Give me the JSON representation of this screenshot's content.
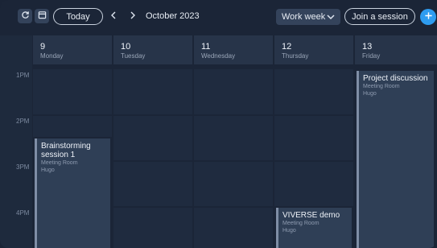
{
  "toolbar": {
    "refresh_icon": "refresh-icon",
    "calendar_icon": "calendar-icon",
    "today_label": "Today",
    "prev_icon": "chevron-left-icon",
    "next_icon": "chevron-right-icon",
    "month_label": "October 2023",
    "view_label": "Work week",
    "join_label": "Join a session",
    "add_icon": "plus-icon"
  },
  "days": [
    {
      "num": "9",
      "name": "Monday"
    },
    {
      "num": "10",
      "name": "Tuesday"
    },
    {
      "num": "11",
      "name": "Wednesday"
    },
    {
      "num": "12",
      "name": "Thursday"
    },
    {
      "num": "13",
      "name": "Friday"
    }
  ],
  "times": [
    "1PM",
    "2PM",
    "3PM",
    "4PM"
  ],
  "events": [
    {
      "title": "Brainstorming session 1",
      "room": "Meeting Room",
      "owner": "Hugo"
    },
    {
      "title": "VIVERSE demo",
      "room": "Meeting Room",
      "owner": "Hugo"
    },
    {
      "title": "Project discussion",
      "room": "Meeting Room",
      "owner": "Hugo"
    }
  ],
  "colors": {
    "accent": "#2e9cf0",
    "background": "#1b2537",
    "event_fill": "#2f3f56",
    "event_bar": "#7f8ea6"
  }
}
